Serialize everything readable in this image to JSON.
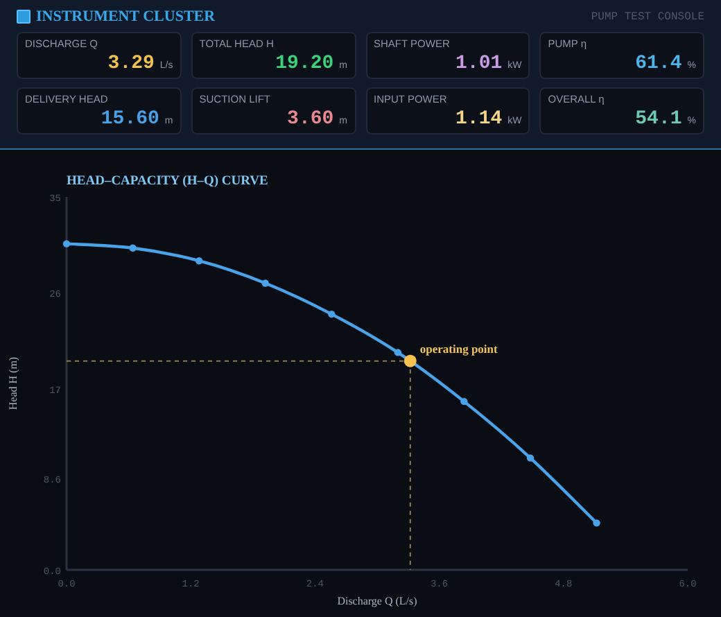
{
  "header": {
    "title": "INSTRUMENT CLUSTER",
    "subtitle": "PUMP TEST CONSOLE"
  },
  "gauges": [
    {
      "label": "DISCHARGE Q",
      "value": "3.29",
      "unit": "L/s",
      "color": "#f2c14e"
    },
    {
      "label": "TOTAL HEAD H",
      "value": "19.20",
      "unit": "m",
      "color": "#3ecf7a"
    },
    {
      "label": "SHAFT POWER",
      "value": "1.01",
      "unit": "kW",
      "color": "#c99be0"
    },
    {
      "label": "PUMP η",
      "value": "61.4",
      "unit": "%",
      "color": "#4fb3e8"
    },
    {
      "label": "DELIVERY HEAD",
      "value": "15.60",
      "unit": "m",
      "color": "#4aa0e6"
    },
    {
      "label": "SUCTION LIFT",
      "value": "3.60",
      "unit": "m",
      "color": "#e8898f"
    },
    {
      "label": "INPUT POWER",
      "value": "1.14",
      "unit": "kW",
      "color": "#f3d58a"
    },
    {
      "label": "OVERALL η",
      "value": "54.1",
      "unit": "%",
      "color": "#6fc8b2"
    }
  ],
  "chart": {
    "chart_data": {
      "type": "line",
      "title": "HEAD–CAPACITY (H–Q) CURVE",
      "xlabel": "Discharge Q (L/s)",
      "ylabel": "Head H (m)",
      "x": [
        0,
        0.64,
        1.28,
        1.92,
        2.56,
        3.2,
        3.84,
        4.48,
        5.12
      ],
      "series": [
        {
          "color": "#4aa3e8",
          "marker": true,
          "values": [
            30.6,
            30.2,
            29.0,
            26.9,
            24.0,
            20.4,
            15.8,
            10.5,
            4.4
          ]
        }
      ],
      "xlim": [
        0,
        6
      ],
      "ylim": [
        0,
        35
      ],
      "xticks": [
        {
          "value": 0,
          "label": "0.0"
        },
        {
          "value": 1.2,
          "label": "1.2"
        },
        {
          "value": 2.4,
          "label": "2.4"
        },
        {
          "value": 3.6,
          "label": "3.6"
        },
        {
          "value": 4.8,
          "label": "4.8"
        },
        {
          "value": 6,
          "label": "6.0"
        }
      ],
      "yticks": [
        {
          "value": 0,
          "label": "0.0"
        },
        {
          "value": 8.6,
          "label": "8.6"
        },
        {
          "value": 17,
          "label": "17"
        },
        {
          "value": 26,
          "label": "26"
        },
        {
          "value": 35,
          "label": "35"
        }
      ],
      "annotations": [
        {
          "x": 3.32,
          "y": 19.6,
          "text": "operating point"
        }
      ]
    }
  }
}
